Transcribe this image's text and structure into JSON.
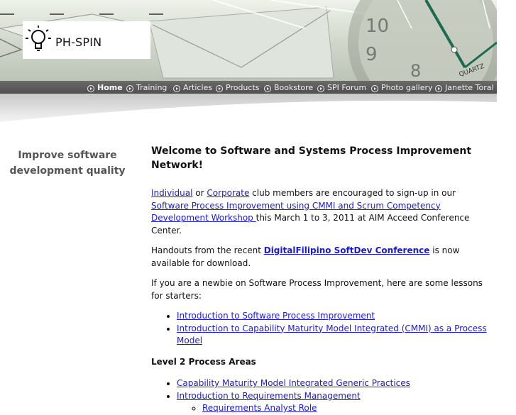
{
  "brand": {
    "name": "PH-SPIN"
  },
  "nav": [
    {
      "label": "Home",
      "active": true
    },
    {
      "label": "Training"
    },
    {
      "label": "Articles"
    },
    {
      "label": "Products"
    },
    {
      "label": "Bookstore"
    },
    {
      "label": "SPI Forum"
    },
    {
      "label": "Photo gallery"
    },
    {
      "label": "Janette Toral"
    }
  ],
  "header_art": {
    "clock_numbers": [
      "10",
      "9",
      "8"
    ],
    "clock_label": "QUARTZ"
  },
  "sidebar": {
    "tagline": "Improve software development quality"
  },
  "main": {
    "title": "Welcome to Software and Systems Process Improvement Network!",
    "p1": {
      "link_individual": "Individual",
      "or": " or ",
      "link_corporate": "Corporate",
      "text1": " club members are encouraged to sign-up in our ",
      "link_workshop": "Software Process Improvement using CMMI and Scrum Competency Development Workshop ",
      "text2": "this March 1 to 3, 2011 at AIM Acceed Conference Center."
    },
    "p2": {
      "text1": "Handouts from the recent ",
      "link": "DigitalFilipino SoftDev Conference",
      "text2": " is now available for download."
    },
    "p3": "If you are a newbie on Software Process Improvement, here are some lessons for starters:",
    "lessons": [
      "Introduction to Software Process Improvement",
      "Introduction to Capability Maturity Model Integrated (CMMI) as a Process Model"
    ],
    "level2_heading": "Level 2 Process Areas",
    "level2": [
      "Capability Maturity Model Integrated Generic Practices",
      "Introduction to Requirements Management"
    ],
    "level2_sub": [
      "Requirements Analyst Role"
    ]
  },
  "colors": {
    "link": "#1a1ad6",
    "navbar": "#555555",
    "sidebar_text": "#555555"
  }
}
